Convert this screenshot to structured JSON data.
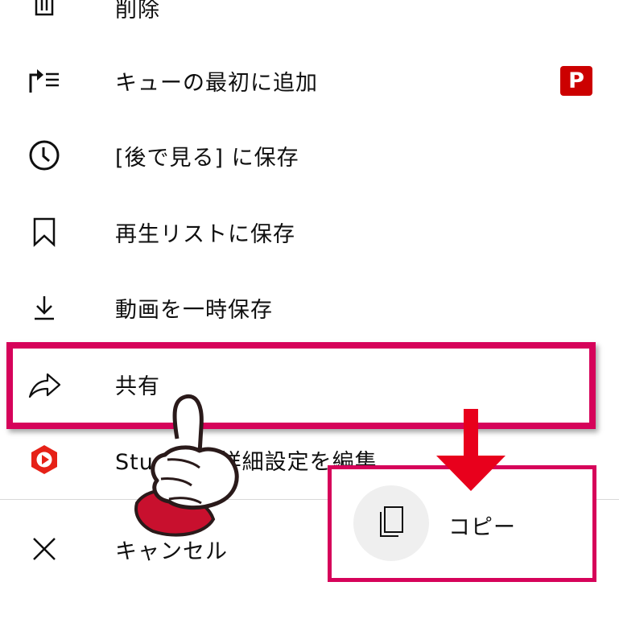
{
  "menu": {
    "items": [
      {
        "label": "削除",
        "icon": "trash-icon"
      },
      {
        "label": "キューの最初に追加",
        "icon": "play-next-queue-icon",
        "badge": "P"
      },
      {
        "label": "[後で見る] に保存",
        "icon": "clock-icon"
      },
      {
        "label": "再生リストに保存",
        "icon": "bookmark-icon"
      },
      {
        "label": "動画を一時保存",
        "icon": "download-icon"
      },
      {
        "label": "共有",
        "icon": "share-arrow-icon"
      },
      {
        "label": "Studio で詳細設定を編集",
        "icon": "youtube-studio-icon"
      },
      {
        "label": "キャンセル",
        "icon": "close-icon"
      }
    ]
  },
  "share_sheet": {
    "copy_label": "コピー",
    "icon": "copy-icon"
  },
  "colors": {
    "highlight": "#d6035a",
    "arrow": "#e8001c",
    "premium_badge": "#cc0000",
    "studio_red": "#e62117"
  }
}
